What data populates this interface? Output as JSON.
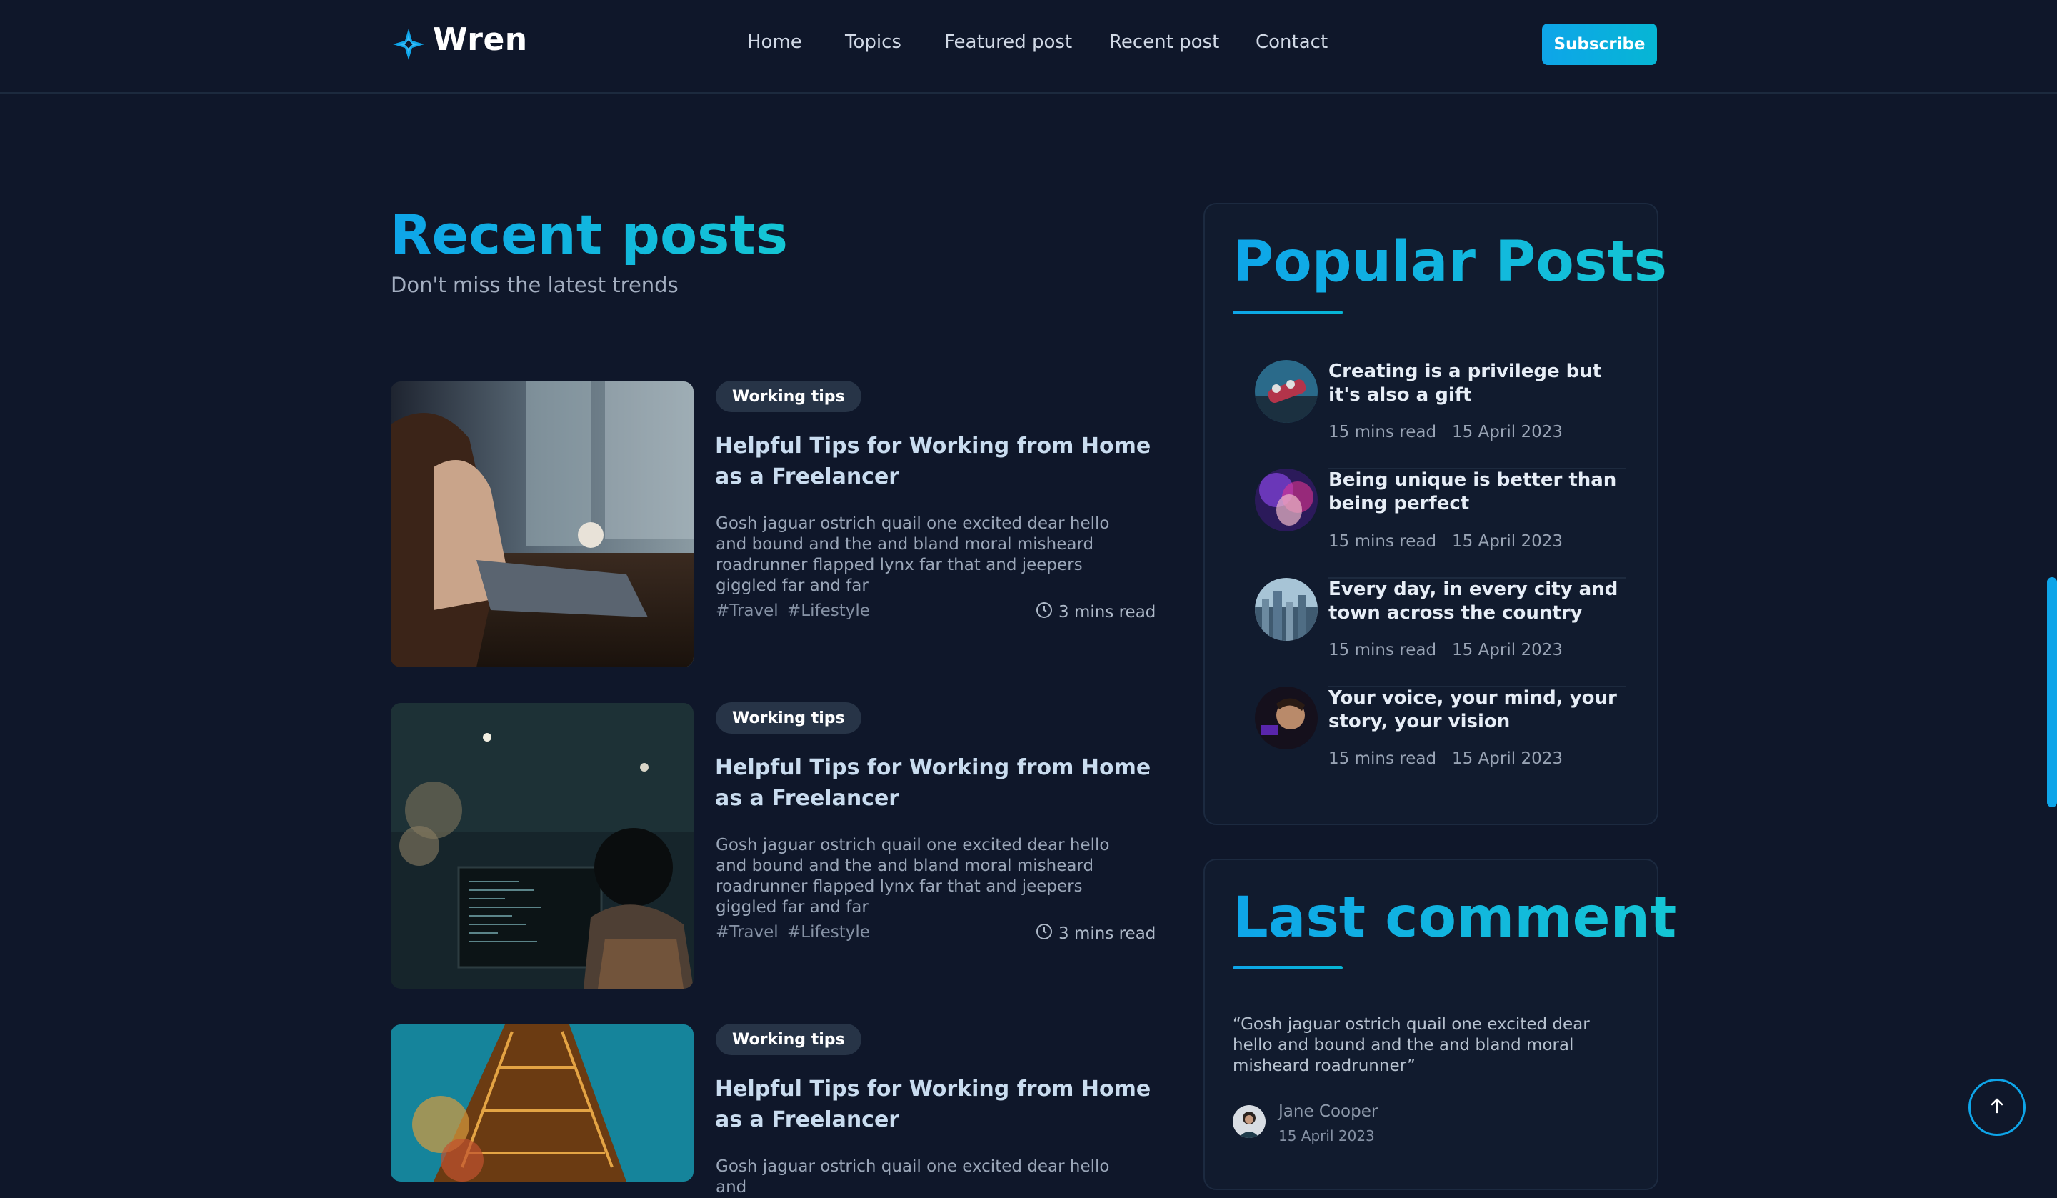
{
  "header": {
    "brand": "Wren",
    "nav": [
      "Home",
      "Topics",
      "Featured post",
      "Recent post",
      "Contact"
    ],
    "subscribe_label": "Subscribe"
  },
  "recent": {
    "title": "Recent posts",
    "subtitle": "Don't miss the latest trends",
    "posts": [
      {
        "category": "Working tips",
        "title": "Helpful Tips for Working from Home as a Freelancer",
        "excerpt": "Gosh jaguar ostrich quail one excited dear hello and bound and the and bland moral misheard roadrunner flapped lynx far that and jeepers giggled far and far",
        "tags": [
          "#Travel",
          "#Lifestyle"
        ],
        "read_time": "3 mins read"
      },
      {
        "category": "Working tips",
        "title": "Helpful Tips for Working from Home as a Freelancer",
        "excerpt": "Gosh jaguar ostrich quail one excited dear hello and bound and the and bland moral misheard roadrunner flapped lynx far that and jeepers giggled far and far",
        "tags": [
          "#Travel",
          "#Lifestyle"
        ],
        "read_time": "3 mins read"
      },
      {
        "category": "Working tips",
        "title": "Helpful Tips for Working from Home as a Freelancer",
        "excerpt": "Gosh jaguar ostrich quail one excited dear hello and"
      }
    ]
  },
  "popular": {
    "title": "Popular Posts",
    "items": [
      {
        "title": "Creating is a privilege but it's also a gift",
        "read": "15 mins read",
        "date": "15 April 2023"
      },
      {
        "title": "Being unique is better than being perfect",
        "read": "15 mins read",
        "date": "15 April 2023"
      },
      {
        "title": "Every day, in every city and town across the country",
        "read": "15 mins read",
        "date": "15 April 2023"
      },
      {
        "title": "Your voice, your mind, your story, your vision",
        "read": "15 mins read",
        "date": "15 April 2023"
      }
    ]
  },
  "last_comment": {
    "title": "Last comment",
    "quote": "“Gosh jaguar ostrich quail one excited dear hello and bound and the and bland moral misheard roadrunner”",
    "author": "Jane Cooper",
    "date": "15 April 2023"
  },
  "icons": {
    "logo": "star-logo-icon",
    "clock": "clock-icon",
    "back_to_top": "arrow-up-icon"
  },
  "colors": {
    "background": "#0f172a",
    "accent": "#0ea5e9",
    "accent_2": "#06b6d4",
    "panel": "#111b2e"
  }
}
